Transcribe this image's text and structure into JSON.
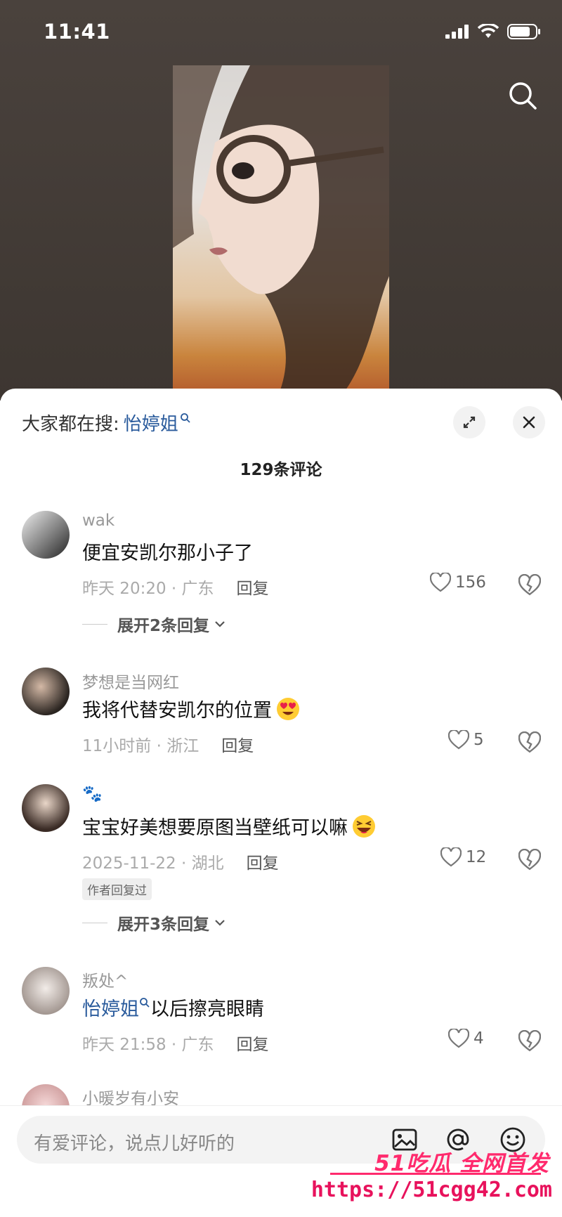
{
  "status_bar": {
    "time": "11:41"
  },
  "hot_search": {
    "label": "大家都在搜:",
    "keyword": "怡婷姐"
  },
  "comment_count": "129条评论",
  "comments": [
    {
      "user": "wak",
      "text": "便宜安凯尔那小子了",
      "emoji": "",
      "meta": "昨天 20:20 · 广东",
      "reply": "回复",
      "likes": "156",
      "expand": "展开2条回复"
    },
    {
      "user": "梦想是当网红",
      "text": "我将代替安凯尔的位置",
      "emoji": "heart-eyes-emoji",
      "meta": "11小时前 · 浙江",
      "reply": "回复",
      "likes": "5"
    },
    {
      "user": "🐾",
      "text": "宝宝好美想要原图当壁纸可以嘛",
      "emoji": "laughing-emoji",
      "meta": "2025-11-22 · 湖北",
      "reply": "回复",
      "likes": "12",
      "badge": "作者回复过",
      "expand": "展开3条回复"
    },
    {
      "user": "叛处^",
      "link": "怡婷姐",
      "text": "以后擦亮眼睛",
      "meta": "昨天 21:58 · 广东",
      "reply": "回复",
      "likes": "4"
    },
    {
      "user": "小暖岁有小安"
    }
  ],
  "input": {
    "placeholder": "有爱评论，说点儿好听的"
  },
  "watermark": {
    "line1": "51吃瓜 全网首发",
    "line2": "https://51cgg42.com"
  },
  "colors": {
    "accent_link": "#2a5b9c",
    "watermark": "#ff2a6d"
  }
}
